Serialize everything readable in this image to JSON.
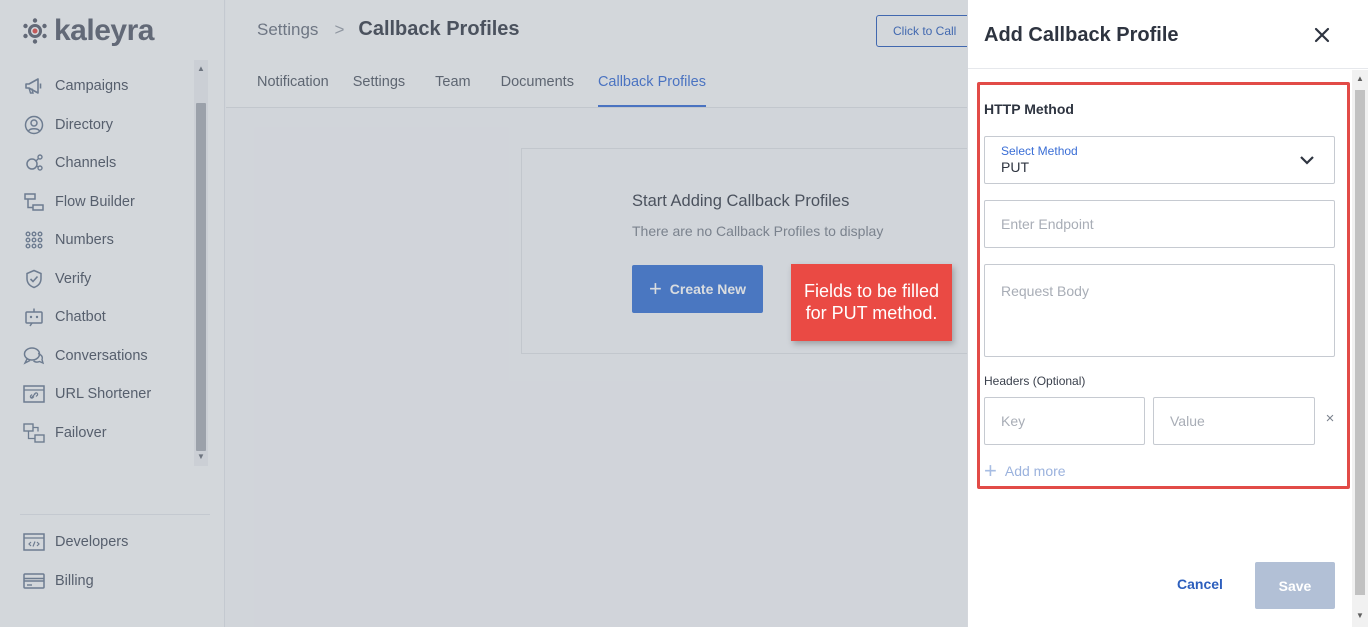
{
  "brand": {
    "name": "kaleyra"
  },
  "sidebar": {
    "items": [
      {
        "label": "Campaigns",
        "icon": "megaphone-icon"
      },
      {
        "label": "Directory",
        "icon": "user-circle-icon"
      },
      {
        "label": "Channels",
        "icon": "channels-icon"
      },
      {
        "label": "Flow Builder",
        "icon": "flow-builder-icon"
      },
      {
        "label": "Numbers",
        "icon": "numbers-grid-icon"
      },
      {
        "label": "Verify",
        "icon": "shield-check-icon"
      },
      {
        "label": "Chatbot",
        "icon": "chatbot-icon"
      },
      {
        "label": "Conversations",
        "icon": "chat-bubbles-icon"
      },
      {
        "label": "URL Shortener",
        "icon": "link-icon"
      },
      {
        "label": "Failover",
        "icon": "failover-icon"
      }
    ],
    "bottom_items": [
      {
        "label": "Developers",
        "icon": "code-icon"
      },
      {
        "label": "Billing",
        "icon": "credit-card-icon"
      }
    ]
  },
  "header": {
    "breadcrumb_parent": "Settings",
    "breadcrumb_separator": ">",
    "breadcrumb_current": "Callback Profiles",
    "click_to_call": "Click to Call"
  },
  "tabs": [
    {
      "label": "Notification"
    },
    {
      "label": "Settings"
    },
    {
      "label": "Team"
    },
    {
      "label": "Documents"
    },
    {
      "label": "Callback Profiles",
      "active": true
    }
  ],
  "empty_state": {
    "title": "Start Adding Callback Profiles",
    "subtitle": "There are no Callback Profiles to display",
    "create_label": "Create New"
  },
  "callout": {
    "text": "Fields to be filled for PUT method."
  },
  "drawer": {
    "title": "Add Callback Profile",
    "section_label": "HTTP Method",
    "method_select": {
      "label": "Select Method",
      "value": "PUT"
    },
    "endpoint_placeholder": "Enter Endpoint",
    "body_placeholder": "Request Body",
    "headers_label": "Headers (Optional)",
    "key_placeholder": "Key",
    "value_placeholder": "Value",
    "remove_glyph": "×",
    "add_more_label": "Add more",
    "cancel_label": "Cancel",
    "save_label": "Save"
  },
  "colors": {
    "accent": "#3a73d6",
    "highlight": "#e24b47",
    "callout": "#ea4a44",
    "save_disabled": "#b2c0d6"
  }
}
